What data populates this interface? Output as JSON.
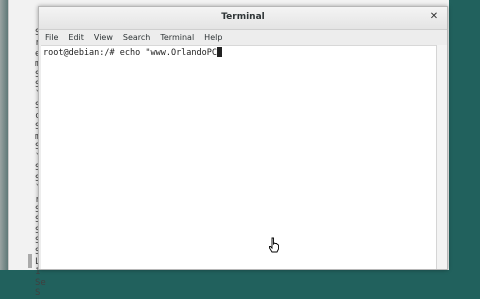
{
  "window": {
    "title": "Terminal"
  },
  "menu": [
    "File",
    "Edit",
    "View",
    "Search",
    "Terminal",
    "Help"
  ],
  "terminal": {
    "prompt": "root@debian:/#",
    "command": " echo \"www.OrlandoPC"
  },
  "background_terminal": {
    "visible_fragments": [
      "Sr",
      "rr",
      "eS",
      "mS",
      "S",
      "St",
      "`t",
      "Sa",
      "cS",
      "St",
      "mS",
      "SS",
      "`S",
      "Sr",
      "Sa",
      "`S",
      "rS",
      "Se",
      "Si",
      "St",
      "St",
      "S",
      "L",
      "1",
      "Se",
      "S"
    ]
  },
  "colors": {
    "desktop": "#21615d",
    "window_bg": "#ededed",
    "terminal_bg": "#ffffff"
  }
}
